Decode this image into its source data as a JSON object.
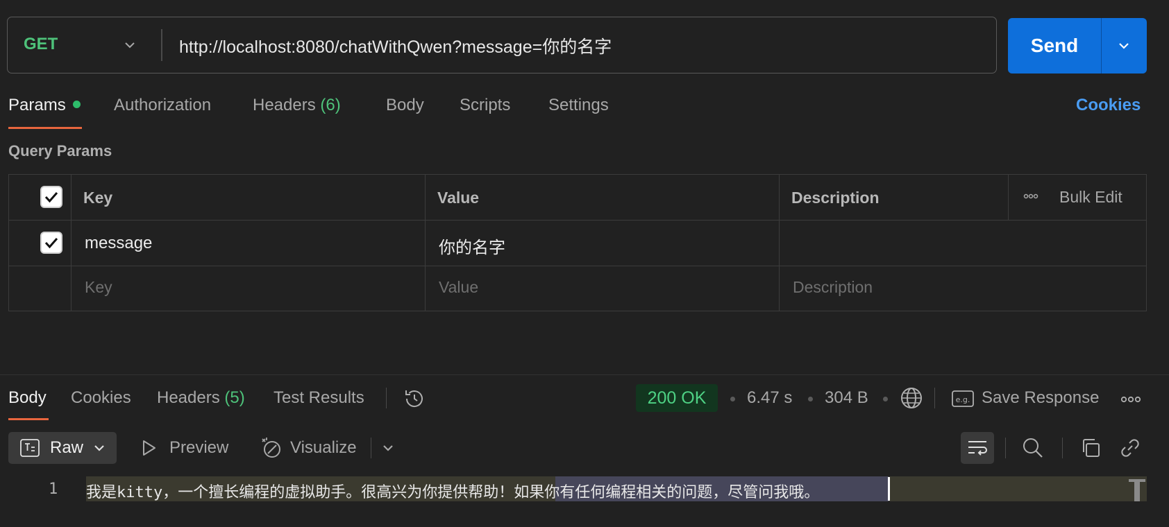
{
  "request": {
    "method": "GET",
    "url": "http://localhost:8080/chatWithQwen?message=你的名字",
    "send_label": "Send"
  },
  "request_tabs": [
    {
      "label": "Params",
      "active": true,
      "has_dot": true
    },
    {
      "label": "Authorization"
    },
    {
      "label": "Headers",
      "count": "(6)"
    },
    {
      "label": "Body"
    },
    {
      "label": "Scripts"
    },
    {
      "label": "Settings"
    }
  ],
  "cookies_link": "Cookies",
  "query_params": {
    "title": "Query Params",
    "headers": {
      "key": "Key",
      "value": "Value",
      "description": "Description",
      "bulk_edit": "Bulk Edit"
    },
    "rows": [
      {
        "checked": true,
        "key": "message",
        "value": "你的名字",
        "description": ""
      }
    ],
    "placeholders": {
      "key": "Key",
      "value": "Value",
      "description": "Description"
    }
  },
  "response": {
    "tabs": [
      {
        "label": "Body",
        "active": true
      },
      {
        "label": "Cookies"
      },
      {
        "label": "Headers",
        "count": "(5)"
      },
      {
        "label": "Test Results"
      }
    ],
    "status": "200 OK",
    "time": "6.47 s",
    "size": "304 B",
    "save_response": "Save Response",
    "format": "Raw",
    "preview": "Preview",
    "visualize": "Visualize",
    "line_number": "1",
    "body_part1": "我是kitty，一个擅长编程的虚拟助手。很高兴为你提供帮助！",
    "body_part2": "如果你有任何编程相关的问题，尽管问我哦。"
  },
  "colors": {
    "accent": "#e8663e",
    "send": "#0e6fdb",
    "method": "#4ec27a",
    "status_ok": "#4ed184",
    "link": "#4a9cf2"
  }
}
